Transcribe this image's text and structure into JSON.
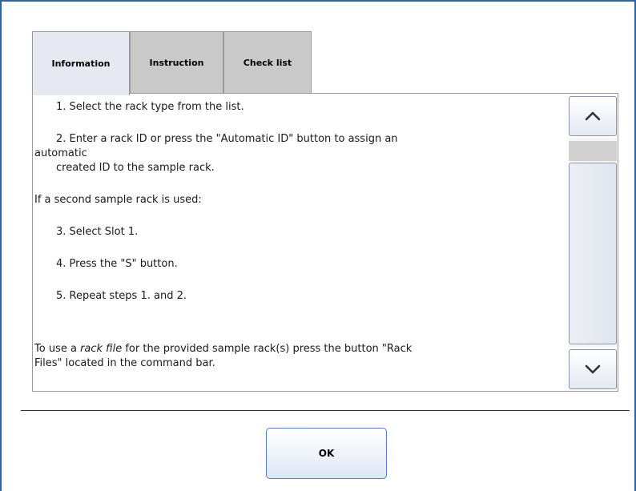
{
  "tabs": [
    {
      "label": "Information",
      "active": true
    },
    {
      "label": "Instruction",
      "active": false
    },
    {
      "label": "Check list",
      "active": false
    }
  ],
  "content": {
    "step1": "1. Select the rack type from the list.",
    "step2a": "2. Enter a rack ID or press the \"Automatic ID\" button to assign an",
    "step2b": "automatic",
    "step2c": "created ID to the sample rack.",
    "second_rack": "If a second sample rack is used:",
    "step3": "3. Select Slot 1.",
    "step4": "4. Press the \"S\" button.",
    "step5": "5. Repeat steps 1. and 2.",
    "rackfile_pre": "To use a ",
    "rackfile_em": "rack file",
    "rackfile_post": " for the provided sample rack(s) press the button \"Rack",
    "rackfile_line2": "Files\" located in the command bar."
  },
  "scrollbar": {
    "up_icon": "chevron-up-icon",
    "down_icon": "chevron-down-icon"
  },
  "footer": {
    "ok_label": "OK"
  },
  "colors": {
    "frame_border": "#2e64a6",
    "active_tab": "#e6e9f1",
    "inactive_tab": "#c9c9c9"
  }
}
